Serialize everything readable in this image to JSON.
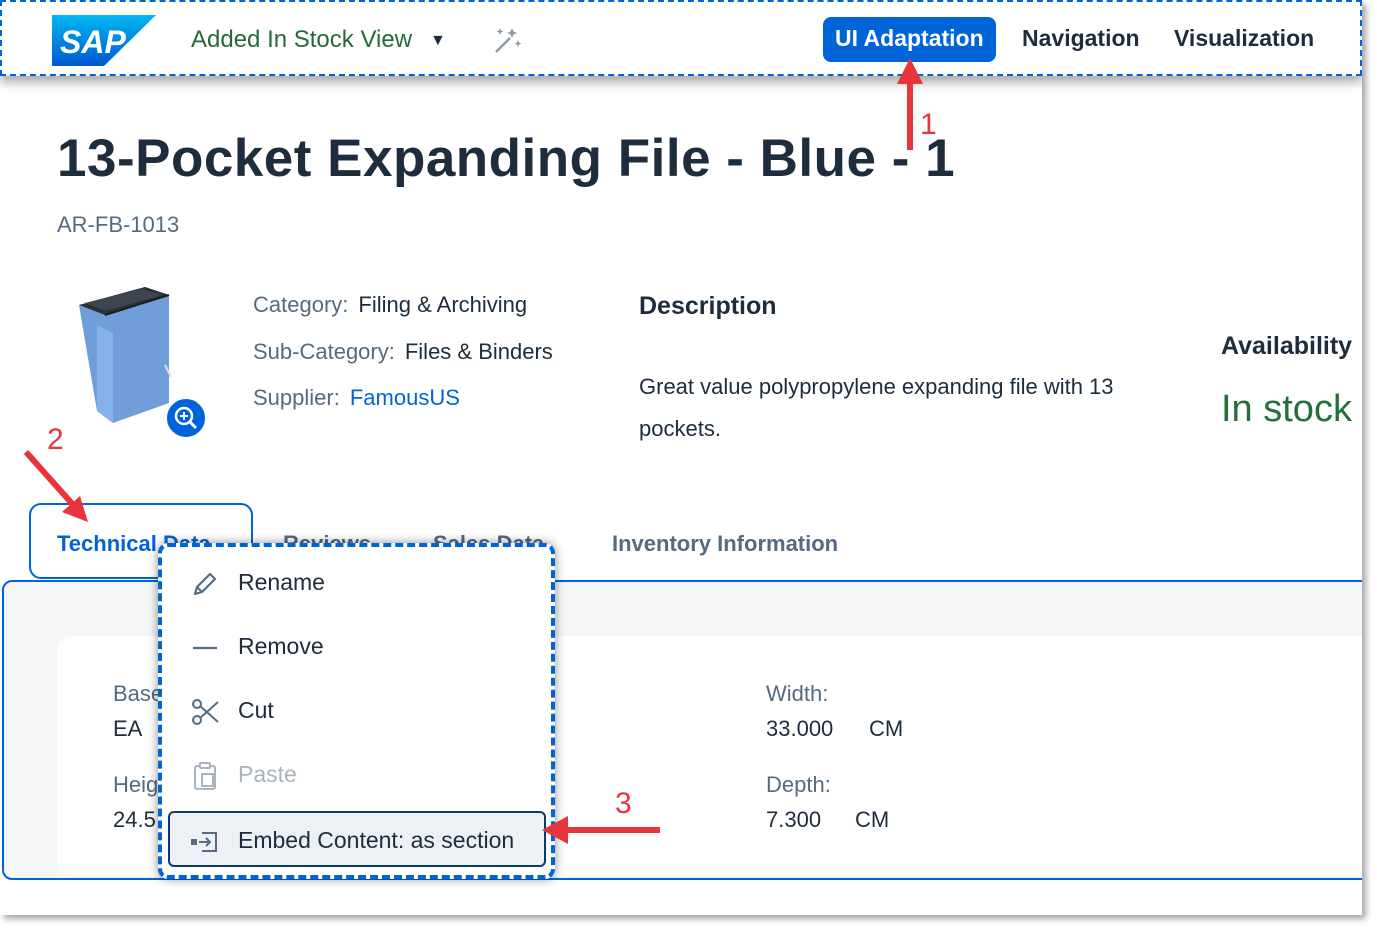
{
  "shell": {
    "logo_text": "SAP",
    "app_title": "Added In Stock View",
    "modes": [
      "UI Adaptation",
      "Navigation",
      "Visualization"
    ],
    "active_mode": "UI Adaptation"
  },
  "header": {
    "title": "13-Pocket Expanding File - Blue - 1",
    "subtitle": "AR-FB-1013",
    "attributes": [
      {
        "label": "Category:",
        "value": "Filing & Archiving"
      },
      {
        "label": "Sub-Category:",
        "value": "Files & Binders"
      },
      {
        "label": "Supplier:",
        "value": "FamousUS"
      }
    ],
    "description_heading": "Description",
    "description_text": "Great value polypropylene expanding file with 13 pockets.",
    "availability_heading": "Availability",
    "availability_value": "In stock"
  },
  "tabs": [
    "Technical Data",
    "Reviews",
    "Sales Data",
    "Inventory Information"
  ],
  "fields": {
    "base_label": "Base",
    "base_value": "EA",
    "height_label": "Heig",
    "height_value": "24.5",
    "width_label": "Width:",
    "width_value": "33.000",
    "width_unit": "CM",
    "depth_label": "Depth:",
    "depth_value": "7.300",
    "depth_unit": "CM"
  },
  "context_menu": {
    "items": [
      {
        "label": "Rename",
        "icon": "pencil-icon",
        "enabled": true
      },
      {
        "label": "Remove",
        "icon": "minus-icon",
        "enabled": true
      },
      {
        "label": "Cut",
        "icon": "scissors-icon",
        "enabled": true
      },
      {
        "label": "Paste",
        "icon": "clipboard-icon",
        "enabled": false
      },
      {
        "label": "Embed Content: as section",
        "icon": "embed-icon",
        "enabled": true,
        "focused": true
      }
    ]
  },
  "annotations": {
    "step1": "1",
    "step2": "2",
    "step3": "3"
  },
  "colors": {
    "accent": "#0064d9",
    "annotation": "#e8343b",
    "success": "#256f3a",
    "title_green": "#246a3a"
  }
}
